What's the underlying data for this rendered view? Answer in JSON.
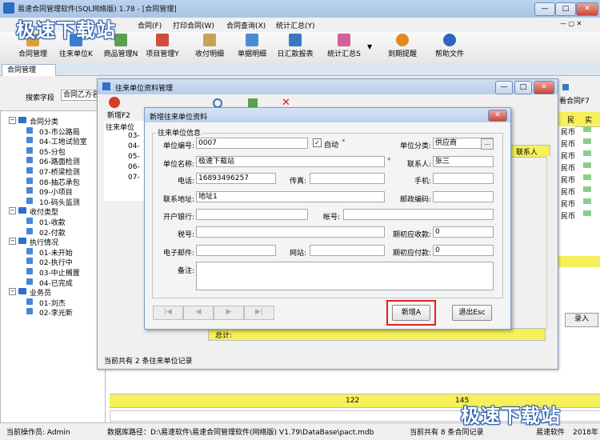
{
  "app": {
    "title": "易速合同管理软件(SQL网络版) 1.78 - [合同管理]",
    "min": "—",
    "max": "□",
    "close": "✕"
  },
  "menu": [
    "合同(F)",
    "打印合同(W)",
    "合同查询(X)",
    "统计汇总(Y)"
  ],
  "toolbar": [
    {
      "label": "合同管理",
      "icon": "clipboard-icon",
      "color": "#e0a030"
    },
    {
      "label": "往来单位K",
      "icon": "people-icon",
      "color": "#3b7fd0"
    },
    {
      "label": "商品管理N",
      "icon": "goods-icon",
      "color": "#5aa050"
    },
    {
      "label": "项目管理Y",
      "icon": "project-icon",
      "color": "#d04c3c"
    },
    {
      "label": "收付明细",
      "icon": "payment-icon",
      "color": "#c9a25a"
    },
    {
      "label": "单据明细",
      "icon": "voucher-icon",
      "color": "#4b8bd6"
    },
    {
      "label": "日汇款报表",
      "icon": "calendar-icon",
      "color": "#3a78c4"
    },
    {
      "label": "统计汇总S",
      "icon": "chart-icon",
      "color": "#d05f9a"
    },
    {
      "label": "到期提醒",
      "icon": "alarm-icon",
      "color": "#e08a20"
    },
    {
      "label": "帮助文件",
      "icon": "help-icon",
      "color": "#2f65c0"
    }
  ],
  "tab": "合同管理",
  "search": {
    "label": "搜索字段",
    "value": "合同乙方名"
  },
  "tree": [
    {
      "label": "合同分类",
      "type": "folder",
      "depth": 0
    },
    {
      "label": "03-市公路局",
      "type": "leaf",
      "depth": 1
    },
    {
      "label": "04-工地试验室",
      "type": "leaf",
      "depth": 1
    },
    {
      "label": "05-分包",
      "type": "leaf",
      "depth": 1
    },
    {
      "label": "06-路面检测",
      "type": "leaf",
      "depth": 1
    },
    {
      "label": "07-桥梁检测",
      "type": "leaf",
      "depth": 1
    },
    {
      "label": "08-抽芯承包",
      "type": "leaf",
      "depth": 1
    },
    {
      "label": "09-小项目",
      "type": "leaf",
      "depth": 1
    },
    {
      "label": "10-码头监测",
      "type": "leaf",
      "depth": 1
    },
    {
      "label": "收付类型",
      "type": "folder",
      "depth": 0
    },
    {
      "label": "01-收款",
      "type": "leaf",
      "depth": 1
    },
    {
      "label": "02-付款",
      "type": "leaf",
      "depth": 1
    },
    {
      "label": "执行情况",
      "type": "folder",
      "depth": 0
    },
    {
      "label": "01-未开始",
      "type": "leaf",
      "depth": 1
    },
    {
      "label": "02-执行中",
      "type": "leaf",
      "depth": 1
    },
    {
      "label": "03-中止搁置",
      "type": "leaf",
      "depth": 1
    },
    {
      "label": "04-已完成",
      "type": "leaf",
      "depth": 1
    },
    {
      "label": "业务员",
      "type": "folder",
      "depth": 0
    },
    {
      "label": "01-刘杰",
      "type": "leaf",
      "depth": 1
    },
    {
      "label": "02-李光新",
      "type": "leaf",
      "depth": 1
    }
  ],
  "right_panel": {
    "view_btn": "看合同F7",
    "col1": "民",
    "col2": "实",
    "cells": [
      "民币",
      "民币",
      "民币",
      "民币",
      "民币",
      "民币",
      "民币",
      "民币"
    ],
    "entry_btn": "录入"
  },
  "bottom_numbers": [
    "122",
    "145"
  ],
  "status": {
    "operator": "当前操作员: Admin",
    "dbpath": "数据库路径：D:\\易速软件\\易速合同管理软件(网络版) V1.79\\DataBase\\pact.mdb",
    "count": "当前共有 8 条合同记录",
    "company": "易速软件",
    "year": "2018年"
  },
  "child": {
    "title": "往来单位资料管理",
    "new_label": "新增F2",
    "tree_root": "往来单位",
    "tree_items": [
      "03-",
      "04-",
      "05-",
      "06-",
      "07-"
    ],
    "col_contact": "联系人",
    "total_label": "总计:",
    "status": "当前共有 2 条往来单位记录"
  },
  "modal": {
    "title": "新增往来单位资料",
    "group": "往来单位信息",
    "code_label": "单位编号:",
    "code_value": "0007",
    "auto_label": "自动",
    "auto_checked": "✓",
    "category_label": "单位分类:",
    "category_value": "供应商",
    "category_btn": "...",
    "name_label": "单位名称:",
    "name_value": "极速下载站",
    "contact_label": "联系人:",
    "contact_value": "张三",
    "phone_label": "电话:",
    "phone_value": "16893496257",
    "fax_label": "传真:",
    "mobile_label": "手机:",
    "address_label": "联系地址:",
    "address_value": "地址1",
    "zip_label": "邮政编码:",
    "bank_label": "开户银行:",
    "account_label": "帐号:",
    "tax_label": "税号:",
    "init_recv_label": "期初应收款:",
    "init_recv_value": "0",
    "email_label": "电子邮件:",
    "web_label": "网站:",
    "init_pay_label": "期初应付款:",
    "init_pay_value": "0",
    "remark_label": "备注:",
    "star": "*",
    "add_btn": "新增A",
    "exit_btn": "退出Esc",
    "nav": [
      "|◀",
      "◀",
      "▶",
      "▶|"
    ]
  },
  "watermark": "极速下载站",
  "colors": {
    "accent": "#2f6fd0",
    "highlight": "#e02020",
    "yellow": "#f6f05a"
  }
}
